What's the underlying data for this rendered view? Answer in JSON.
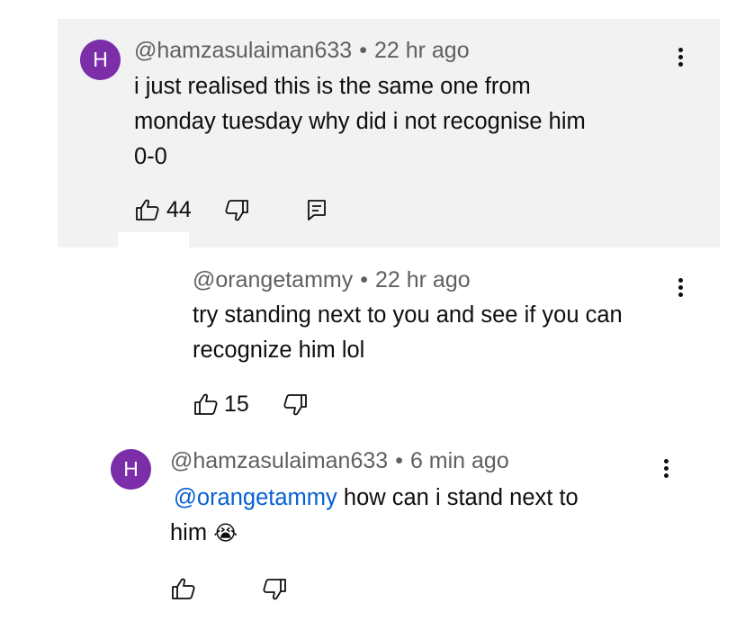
{
  "comment": {
    "avatar_initial": "H",
    "author": "@hamzasulaiman633",
    "separator": "•",
    "time": "22 hr ago",
    "lines": [
      "i just realised this is the same one from",
      "monday tuesday why did i not recognise him",
      "0-0"
    ],
    "likes": "44"
  },
  "reply_1": {
    "author": "@orangetammy",
    "separator": "•",
    "time": "22 hr ago",
    "lines": [
      "try standing next to you and see if you can",
      "recognize him lol"
    ],
    "likes": "15"
  },
  "reply_2": {
    "avatar_initial": "H",
    "author": "@hamzasulaiman633",
    "separator": "•",
    "time": "6 min ago",
    "mention": "@orangetammy",
    "line1_rest": " how can i stand next to",
    "line2_text": "him ",
    "emoji": "😭"
  },
  "colors": {
    "highlight_bg": "#f2f2f2",
    "avatar": "#7b2ea8",
    "mention": "#065fd4",
    "meta_text": "#606060"
  },
  "icons": [
    "thumbs-up-icon",
    "thumbs-down-icon",
    "reply-icon",
    "more-vert-icon"
  ]
}
